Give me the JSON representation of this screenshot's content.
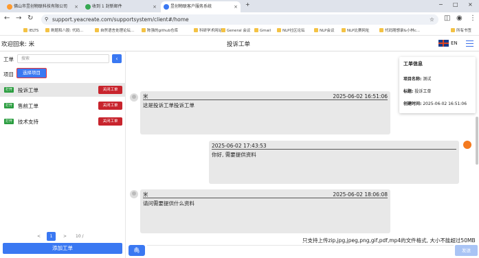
{
  "browser": {
    "tabs": [
      {
        "label": "佛山市昱创物联科技有限公司",
        "color": "#ff9a2e"
      },
      {
        "label": "收到 1 封新邮件",
        "color": "#36a852"
      },
      {
        "label": "昱创物联客户服务系统",
        "color": "#3a78f2"
      }
    ],
    "url": "support.yeacreate.com/supportsystem/client#/home",
    "bookmarks": [
      "IELTS",
      "刷题和八股: 代码...",
      "自然语言处理论坛...",
      "陈强的github仓库",
      "科研学术网站",
      "General 会议",
      "Gmail",
      "NLP社区论坛",
      "NLP会议",
      "NLP比赛网址",
      "代码随想录&小林c..."
    ],
    "all_bookmarks": "所有书签"
  },
  "header": {
    "welcome": "欢迎回来: 米",
    "title": "投诉工单",
    "lang": "EN"
  },
  "sidebar": {
    "ticket_label": "工单",
    "search_placeholder": "搜索",
    "search_btn": "‹",
    "project_label": "项目",
    "select_project": "选择项目",
    "tickets": [
      {
        "status": "打开",
        "name": "投诉工单",
        "close": "关闭工单"
      },
      {
        "status": "打开",
        "name": "售前工单",
        "close": "关闭工单"
      },
      {
        "status": "打开",
        "name": "技术支持",
        "close": "关闭工单"
      }
    ],
    "pager": {
      "prev": "<",
      "page": "1",
      "next": ">",
      "size": "10 /"
    },
    "add_ticket": "添加工单"
  },
  "chat": {
    "messages": [
      {
        "sender": "米",
        "time": "2025-06-02 16:51:06",
        "text": "这是投诉工单投诉工单"
      },
      {
        "sender": "",
        "time": "2025-06-02 17:43:53",
        "text": "你好, 需要提供资料"
      },
      {
        "sender": "米",
        "time": "2025-06-02 18:06:08",
        "text": "请问需要提供什么资料"
      }
    ],
    "upload_note": "只支持上传zip,jpg,jpeg,png,gif,pdf,mp4的文件格式, 大小不能超过50MB",
    "send": "发送"
  },
  "info": {
    "title": "工单信息",
    "project_key": "项目名称:",
    "project_val": "测试",
    "subject_key": "标题:",
    "subject_val": "投诉工单",
    "created_key": "创建时间:",
    "created_val": "2025-06-02 16:51:06"
  }
}
